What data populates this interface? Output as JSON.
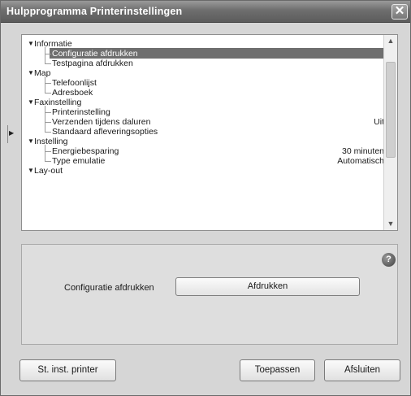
{
  "window": {
    "title": "Hulpprogramma Printerinstellingen",
    "close_glyph": "✕"
  },
  "tree": {
    "categories": [
      {
        "label": "Informatie",
        "items": [
          {
            "label": "Configuratie afdrukken",
            "value": "",
            "selected": true
          },
          {
            "label": "Testpagina afdrukken",
            "value": "",
            "selected": false
          }
        ]
      },
      {
        "label": "Map",
        "items": [
          {
            "label": "Telefoonlijst",
            "value": "",
            "selected": false
          },
          {
            "label": "Adresboek",
            "value": "",
            "selected": false
          }
        ]
      },
      {
        "label": "Faxinstelling",
        "items": [
          {
            "label": "Printerinstelling",
            "value": "",
            "selected": false
          },
          {
            "label": "Verzenden tijdens daluren",
            "value": "Uit",
            "selected": false
          },
          {
            "label": "Standaard afleveringsopties",
            "value": "",
            "selected": false
          }
        ]
      },
      {
        "label": "Instelling",
        "items": [
          {
            "label": "Energiebesparing",
            "value": "30 minuten",
            "selected": false
          },
          {
            "label": "Type emulatie",
            "value": "Automatisch",
            "selected": false
          }
        ]
      },
      {
        "label": "Lay-out",
        "items": []
      }
    ]
  },
  "detail": {
    "label": "Configuratie afdrukken",
    "button_label": "Afdrukken",
    "help_glyph": "?"
  },
  "footer": {
    "printer_button": "St. inst. printer",
    "apply_button": "Toepassen",
    "close_button": "Afsluiten"
  },
  "icons": {
    "caret": "caret-down-icon",
    "help": "help-icon",
    "close": "close-icon"
  }
}
